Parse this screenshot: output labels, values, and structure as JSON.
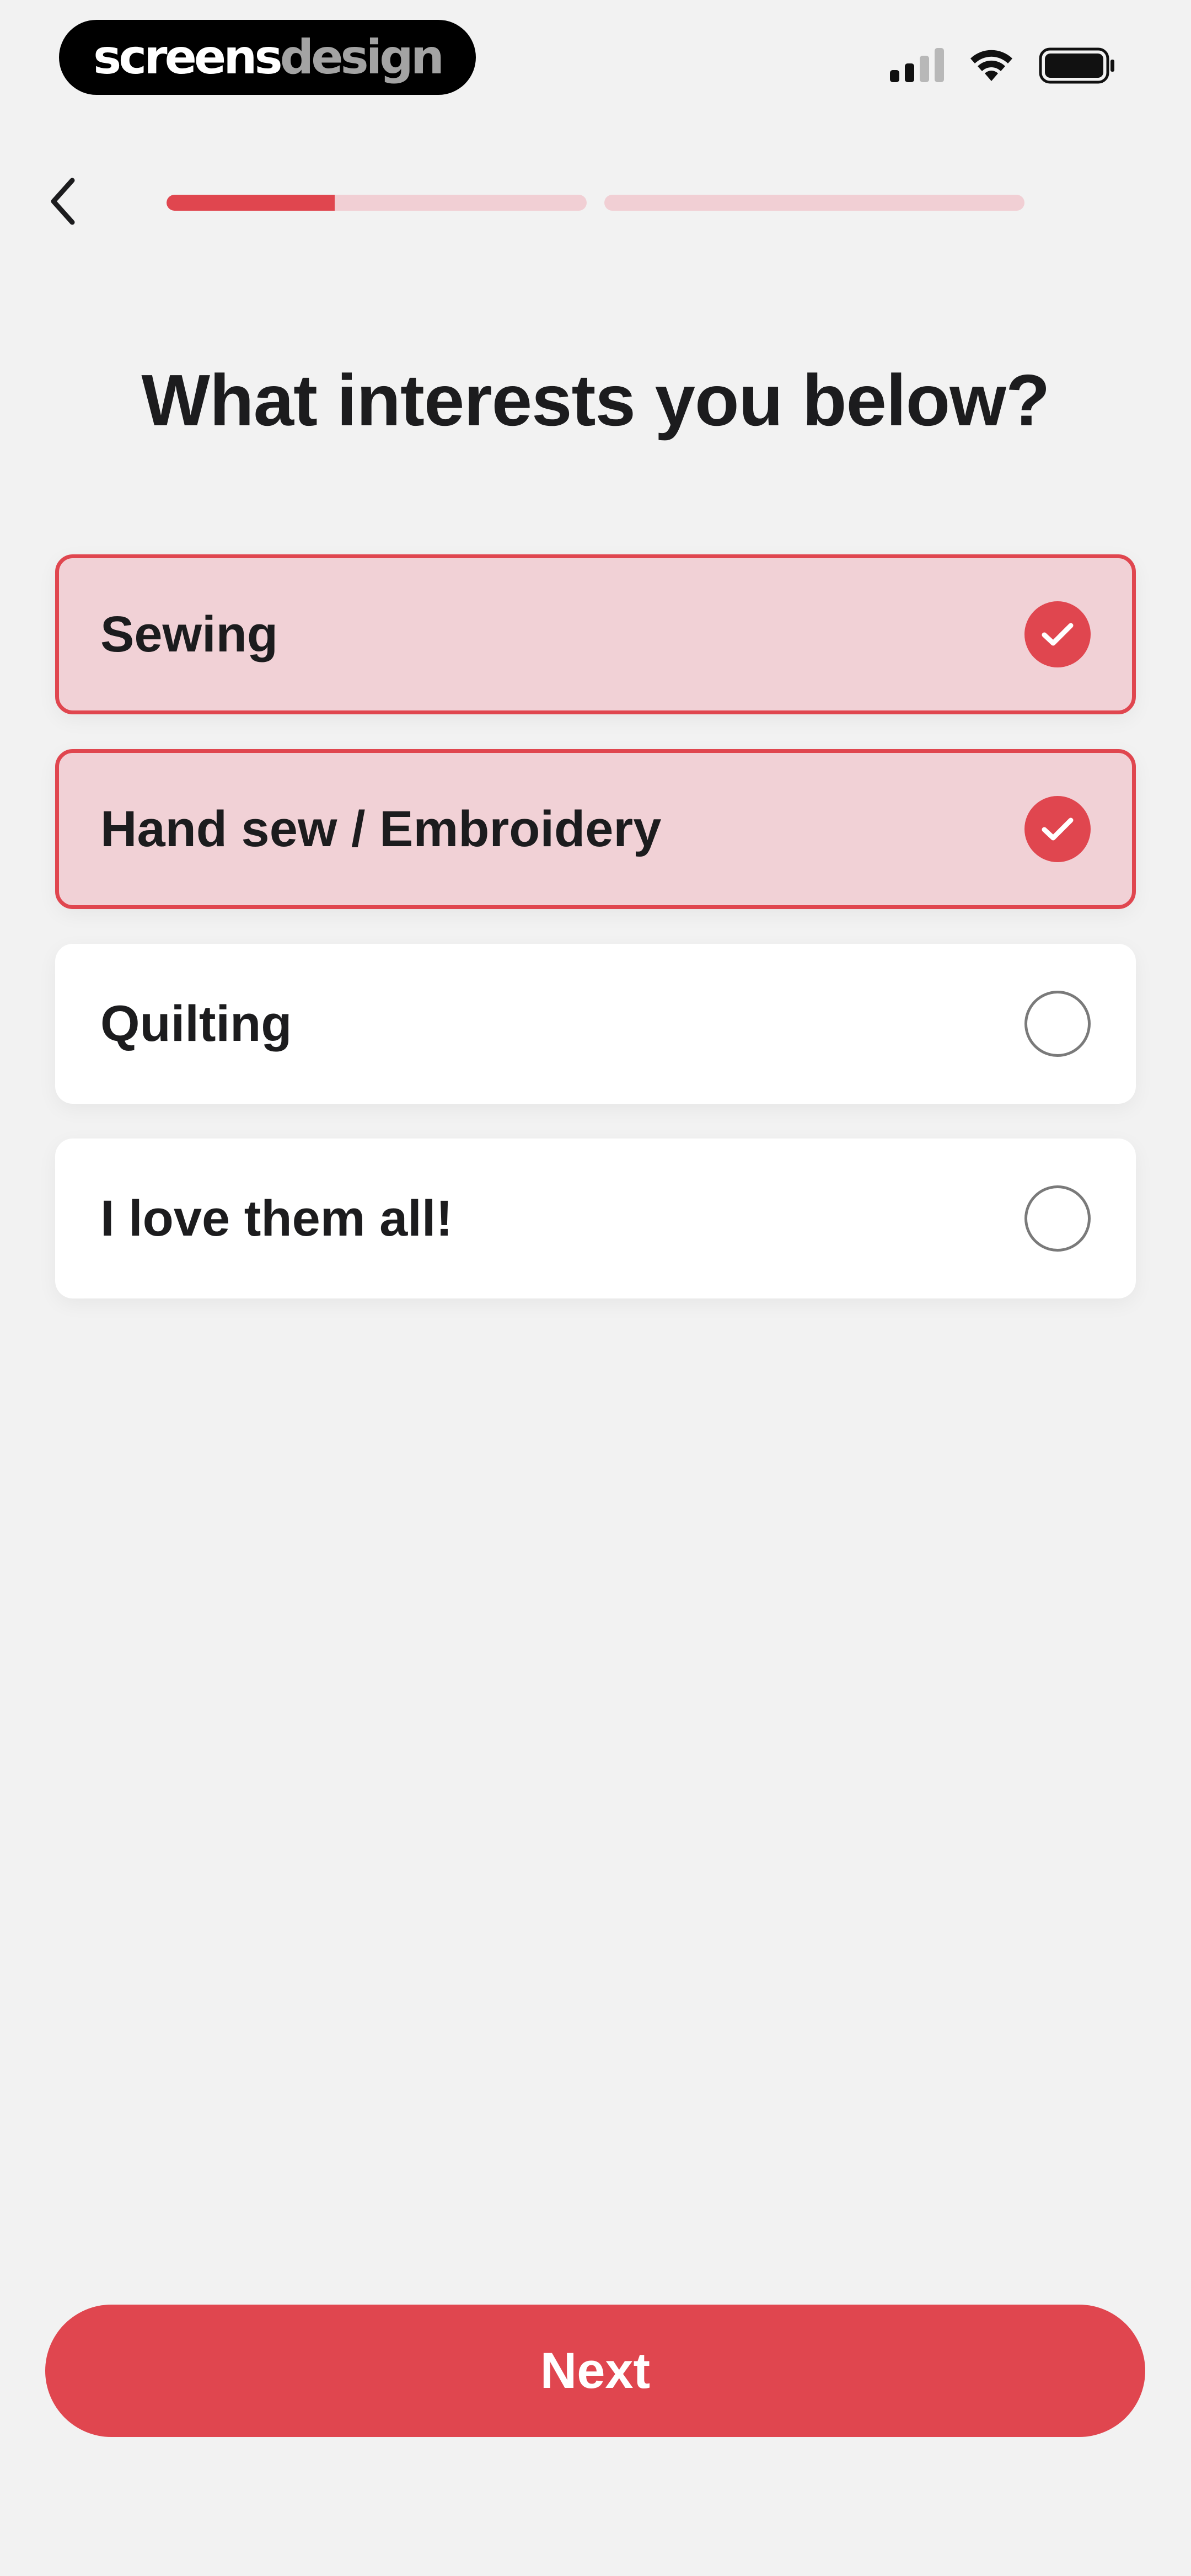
{
  "status_bar": {
    "brand": {
      "part1": "screens",
      "part2": "design"
    },
    "icons": [
      "cellular-signal-icon",
      "wifi-icon",
      "battery-icon"
    ]
  },
  "nav": {
    "back_icon": "chevron-left-icon",
    "progress": [
      {
        "fill": 0.4
      },
      {
        "fill": 0
      }
    ]
  },
  "title": "What interests you below?",
  "options": [
    {
      "label": "Sewing",
      "selected": true
    },
    {
      "label": "Hand sew / Embroidery",
      "selected": true
    },
    {
      "label": "Quilting",
      "selected": false
    },
    {
      "label": "I love them all!",
      "selected": false
    }
  ],
  "next_label": "Next",
  "colors": {
    "accent": "#e0464f",
    "selected_bg": "#f1d1d6",
    "track": "#f1cfd4",
    "background": "#f2f2f2"
  }
}
